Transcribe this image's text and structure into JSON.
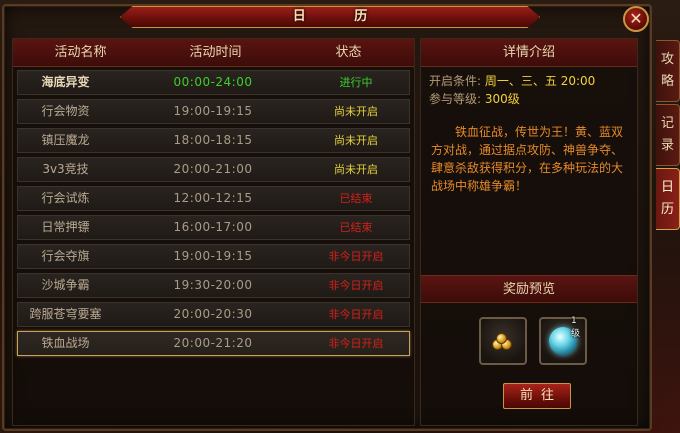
{
  "window": {
    "title": "日 历",
    "close_label": "✕"
  },
  "list": {
    "headers": [
      "活动名称",
      "活动时间",
      "状态"
    ],
    "rows": [
      {
        "name": "海底异变",
        "time": "00:00-24:00",
        "status": "进行中",
        "status_color": "#3ccf2c",
        "name_color": "#e8d8b8",
        "time_color": "#3ccf2c"
      },
      {
        "name": "行会物资",
        "time": "19:00-19:15",
        "status": "尚未开启",
        "status_color": "#e6d23a"
      },
      {
        "name": "镇压魔龙",
        "time": "18:00-18:15",
        "status": "尚未开启",
        "status_color": "#e6d23a"
      },
      {
        "name": "3v3竞技",
        "time": "20:00-21:00",
        "status": "尚未开启",
        "status_color": "#e6d23a"
      },
      {
        "name": "行会试炼",
        "time": "12:00-12:15",
        "status": "已结束",
        "status_color": "#d4201a"
      },
      {
        "name": "日常押镖",
        "time": "16:00-17:00",
        "status": "已结束",
        "status_color": "#d4201a"
      },
      {
        "name": "行会夺旗",
        "time": "19:00-19:15",
        "status": "非今日开启",
        "status_color": "#d4201a"
      },
      {
        "name": "沙城争霸",
        "time": "19:30-20:00",
        "status": "非今日开启",
        "status_color": "#d4201a"
      },
      {
        "name": "跨服苍穹要塞",
        "time": "20:00-20:30",
        "status": "非今日开启",
        "status_color": "#d4201a"
      },
      {
        "name": "铁血战场",
        "time": "20:00-21:20",
        "status": "非今日开启",
        "status_color": "#d4201a"
      }
    ],
    "selected_index": 9
  },
  "detail": {
    "header": "详情介绍",
    "open_label": "开启条件:",
    "open_value": "周一、三、五 20:00",
    "level_label": "参与等级:",
    "level_value": "300级",
    "description": "铁血征战，传世为王！黄、蓝双方对战，通过据点攻防、神兽争夺、肆意杀敌获得积分，在多种玩法的大战场中称雄争霸！",
    "reward_header": "奖励预览",
    "rewards": [
      {
        "icon": "gold-coins-icon",
        "badge": ""
      },
      {
        "icon": "blue-orb-icon",
        "badge": "1级"
      }
    ],
    "go_button": "前往"
  },
  "side_tabs": [
    {
      "label": [
        "攻",
        "略"
      ],
      "active": false
    },
    {
      "label": [
        "记",
        "录"
      ],
      "active": false
    },
    {
      "label": [
        "日",
        "历"
      ],
      "active": true
    }
  ]
}
